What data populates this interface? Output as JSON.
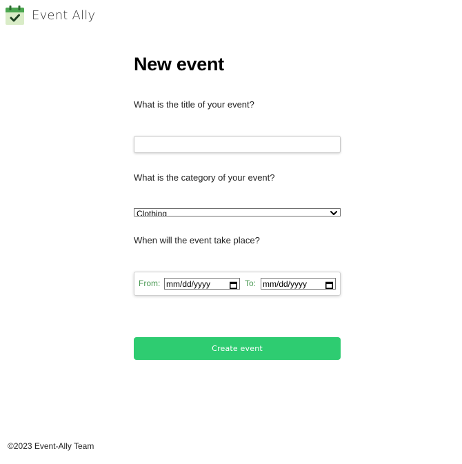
{
  "app": {
    "brand_name": "Event Ally",
    "logo_icon": "calendar-check-icon",
    "accent_color": "#2ecc71"
  },
  "form": {
    "heading": "New event",
    "title_question": "What is the title of your event?",
    "title_value": "",
    "category_question": "What is the category of your event?",
    "category_selected": "Clothing",
    "date_question": "When will the event take place?",
    "from_label": "From:",
    "from_placeholder": "mm/dd/yyyy",
    "to_label": "To:",
    "to_placeholder": "mm/dd/yyyy",
    "submit_label": "Create event"
  },
  "footer": {
    "copyright": "©2023 Event-Ally Team"
  }
}
